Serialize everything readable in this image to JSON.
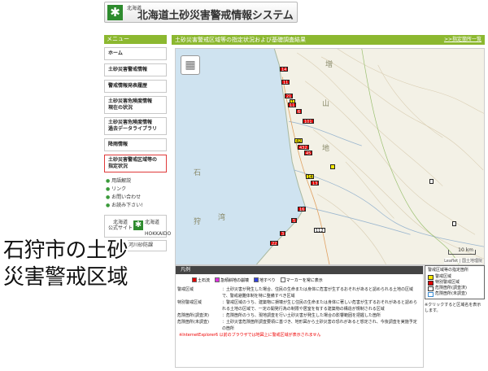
{
  "header": {
    "subtitle": "北海道",
    "title": "北海道土砂災害警戒情報システム",
    "logo_icon": "hokkaido-crest-icon"
  },
  "sidebar": {
    "heading": "メニュー",
    "items": [
      {
        "label": "ホーム"
      },
      {
        "label": "土砂災害警戒情報"
      },
      {
        "label": "警戒情報発表履歴"
      },
      {
        "label": "土砂災害危険度情報\n現在の状況"
      },
      {
        "label": "土砂災害危険度情報\n過去データライブラリ"
      },
      {
        "label": "降雨情報"
      },
      {
        "label": "土砂災害警戒区域等の\n指定状況",
        "selected": true
      }
    ],
    "links": [
      {
        "label": "用語解説"
      },
      {
        "label": "リンク"
      },
      {
        "label": "お問い合わせ"
      },
      {
        "label": "お読み下さい!"
      }
    ],
    "banner": {
      "left": "北海道\n公式サイト",
      "right": "北海道\n　HOKKAIDO",
      "second": "北海道　河川砂防課"
    }
  },
  "main": {
    "heading": "土砂災害警戒区域等の指定状況および基礎調査結果",
    "heading_link": ">>指定箇所一覧",
    "map": {
      "labels": [
        "石",
        "狩",
        "湾",
        "山",
        "地",
        "増"
      ],
      "pins": [
        "14",
        "11",
        "21",
        "1",
        "11",
        "6",
        "101",
        "42",
        "432",
        "45",
        "14",
        "13",
        "16",
        "5",
        "3",
        "22",
        "112"
      ],
      "scale": "10 km",
      "attribution": "Leaflet | 国土地理院"
    },
    "overlay_caption": "石狩市の土砂\n災害警戒区域"
  },
  "legend": {
    "title": "凡例",
    "checkboxes": [
      {
        "label": "土石流",
        "color": "#e00000"
      },
      {
        "label": "急傾斜地の崩壊",
        "color": "#e030e0"
      },
      {
        "label": "地すべり",
        "color": "#3040e0"
      },
      {
        "label": "マーカーを常に表示",
        "color": "#ffffff"
      }
    ],
    "definitions": [
      {
        "key": "警戒区域",
        "text": "：土砂災害が発生した場合、住民の生命または身体に危害が生ずるおそれがあると認められる土地の区域で、警戒避難体制を特に整備すべき区域"
      },
      {
        "key": "特別警戒区域",
        "text": "：警戒区域のうち、建築物に損壊が生じ住民の生命または身体に著しい危害が生ずるおそれがあると認められる土地の区域で、一定の開発行為の制限や居室を有する建築物の構造が規制される区域"
      },
      {
        "key": "危険箇所(調査済)",
        "text": "：危険箇所のうち、現地調査を行い土砂災害が発生した場合の影響範囲を把握した箇所"
      },
      {
        "key": "危険箇所(未調査)",
        "text": "：土砂災害危険箇所調査要領に基づき、地形図から土砂災害の恐れがあると想定され、今後調査を実施予定の箇所"
      }
    ],
    "warning": "※InternetExplorer6 以前のブラウザでは地図上に警戒区域が表示されません"
  },
  "legend_side": {
    "title": "警戒区域等の指定箇所",
    "items": [
      {
        "label": "警戒区域",
        "color": "#f5e600"
      },
      {
        "label": "特別警戒区域",
        "color": "#e00000"
      },
      {
        "label": "危険箇所(調査済)",
        "color": "#ffffff"
      },
      {
        "label": "危険箇所(未調査)",
        "color": "#ffffff"
      }
    ],
    "note": "※クリックすると区域名を表示します。"
  }
}
